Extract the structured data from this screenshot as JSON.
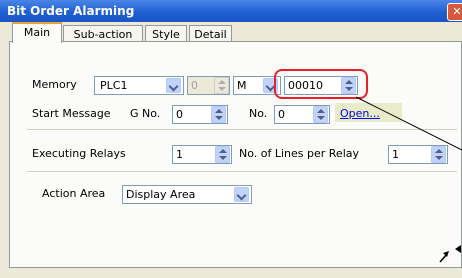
{
  "window": {
    "title": "Bit Order Alarming",
    "close_glyph": "✕"
  },
  "tabs": [
    {
      "label": "Main",
      "active": true
    },
    {
      "label": "Sub-action",
      "active": false
    },
    {
      "label": "Style",
      "active": false
    },
    {
      "label": "Detail",
      "active": false
    }
  ],
  "memory": {
    "label": "Memory",
    "plc": "PLC1",
    "station": "0",
    "device": "M",
    "address": "00010"
  },
  "start_message": {
    "label": "Start Message",
    "g_no_label": "G No.",
    "g_no_value": "0",
    "no_label": "No.",
    "no_value": "0",
    "open_link": "Open..."
  },
  "executing_relays": {
    "label": "Executing Relays",
    "value": "1",
    "lines_label": "No. of Lines per Relay",
    "lines_value": "1"
  },
  "action_area": {
    "label": "Action Area",
    "value": "Display Area"
  },
  "colors": {
    "highlight": "#e8202a",
    "title_bar": "#1f5fd1",
    "link": "#0000ee"
  }
}
